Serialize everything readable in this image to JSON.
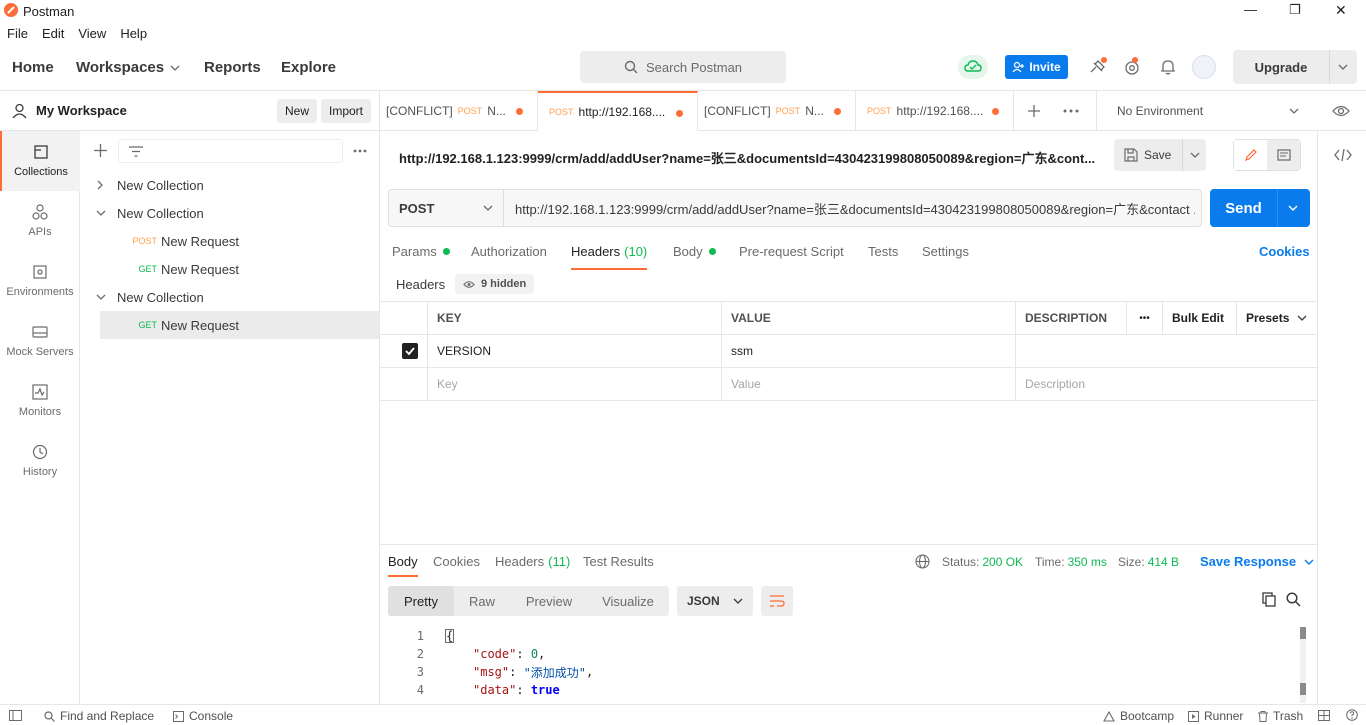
{
  "window": {
    "title": "Postman",
    "minimize": "—",
    "maximize": "❐",
    "close": "✕"
  },
  "menu": [
    "File",
    "Edit",
    "View",
    "Help"
  ],
  "nav": {
    "home": "Home",
    "workspaces": "Workspaces",
    "reports": "Reports",
    "explore": "Explore",
    "search_placeholder": "Search Postman",
    "invite": "Invite",
    "upgrade": "Upgrade"
  },
  "workspace": {
    "name": "My Workspace",
    "new": "New",
    "import": "Import"
  },
  "tabs": [
    {
      "prefix": "[CONFLICT]",
      "method": "POST",
      "label": "N..."
    },
    {
      "prefix": "",
      "method": "POST",
      "label": "http://192.168...."
    },
    {
      "prefix": "[CONFLICT]",
      "method": "POST",
      "label": "N..."
    },
    {
      "prefix": "",
      "method": "POST",
      "label": "http://192.168...."
    }
  ],
  "environment": "No Environment",
  "rail": [
    {
      "label": "Collections",
      "icon": "collections-icon"
    },
    {
      "label": "APIs",
      "icon": "apis-icon"
    },
    {
      "label": "Environments",
      "icon": "environments-icon"
    },
    {
      "label": "Mock Servers",
      "icon": "mock-servers-icon"
    },
    {
      "label": "Monitors",
      "icon": "monitors-icon"
    },
    {
      "label": "History",
      "icon": "history-icon"
    }
  ],
  "tree": [
    {
      "label": "New Collection",
      "expanded": false
    },
    {
      "label": "New Collection",
      "expanded": true
    },
    {
      "method": "POST",
      "label": "New Request"
    },
    {
      "method": "GET",
      "label": "New Request"
    },
    {
      "label": "New Collection",
      "expanded": true
    },
    {
      "method": "GET",
      "label": "New Request"
    }
  ],
  "request": {
    "title": "http://192.168.1.123:9999/crm/add/addUser?name=张三&documentsId=430423199808050089&region=广东&cont...",
    "save": "Save",
    "method": "POST",
    "url": "http://192.168.1.123:9999/crm/add/addUser?name=张三&documentsId=430423199808050089&region=广东&contact ...",
    "send": "Send",
    "tabs": {
      "params": "Params",
      "authorization": "Authorization",
      "headers": "Headers",
      "headers_count": "(10)",
      "body": "Body",
      "prerequest": "Pre-request Script",
      "tests": "Tests",
      "settings": "Settings",
      "cookies": "Cookies"
    },
    "headers_label": "Headers",
    "hidden": "9 hidden",
    "columns": {
      "key": "KEY",
      "value": "VALUE",
      "description": "DESCRIPTION",
      "more": "•••",
      "bulk": "Bulk Edit",
      "presets": "Presets"
    },
    "rows": [
      {
        "key": "VERSION",
        "value": "ssm",
        "description": ""
      }
    ],
    "placeholders": {
      "key": "Key",
      "value": "Value",
      "description": "Description"
    }
  },
  "response": {
    "tabs": {
      "body": "Body",
      "cookies": "Cookies",
      "headers": "Headers",
      "headers_count": "(11)",
      "tests": "Test Results"
    },
    "status_label": "Status:",
    "status": "200 OK",
    "time_label": "Time:",
    "time": "350 ms",
    "size_label": "Size:",
    "size": "414 B",
    "save": "Save Response",
    "view": {
      "pretty": "Pretty",
      "raw": "Raw",
      "preview": "Preview",
      "visualize": "Visualize",
      "format": "JSON"
    },
    "lines": [
      {
        "n": "1",
        "text": "{"
      },
      {
        "n": "2",
        "key": "\"code\"",
        "sep": ": ",
        "val": "0",
        "end": ","
      },
      {
        "n": "3",
        "key": "\"msg\"",
        "sep": ": ",
        "val": "\"添加成功\"",
        "end": ","
      },
      {
        "n": "4",
        "key": "\"data\"",
        "sep": ": ",
        "val": "true",
        "end": ""
      }
    ]
  },
  "footer": {
    "find": "Find and Replace",
    "console": "Console",
    "bootcamp": "Bootcamp",
    "runner": "Runner",
    "trash": "Trash"
  },
  "colors": {
    "accent": "#ff6c37",
    "blue": "#097bed",
    "post": "#ffa14f",
    "get": "#0cbb52"
  }
}
